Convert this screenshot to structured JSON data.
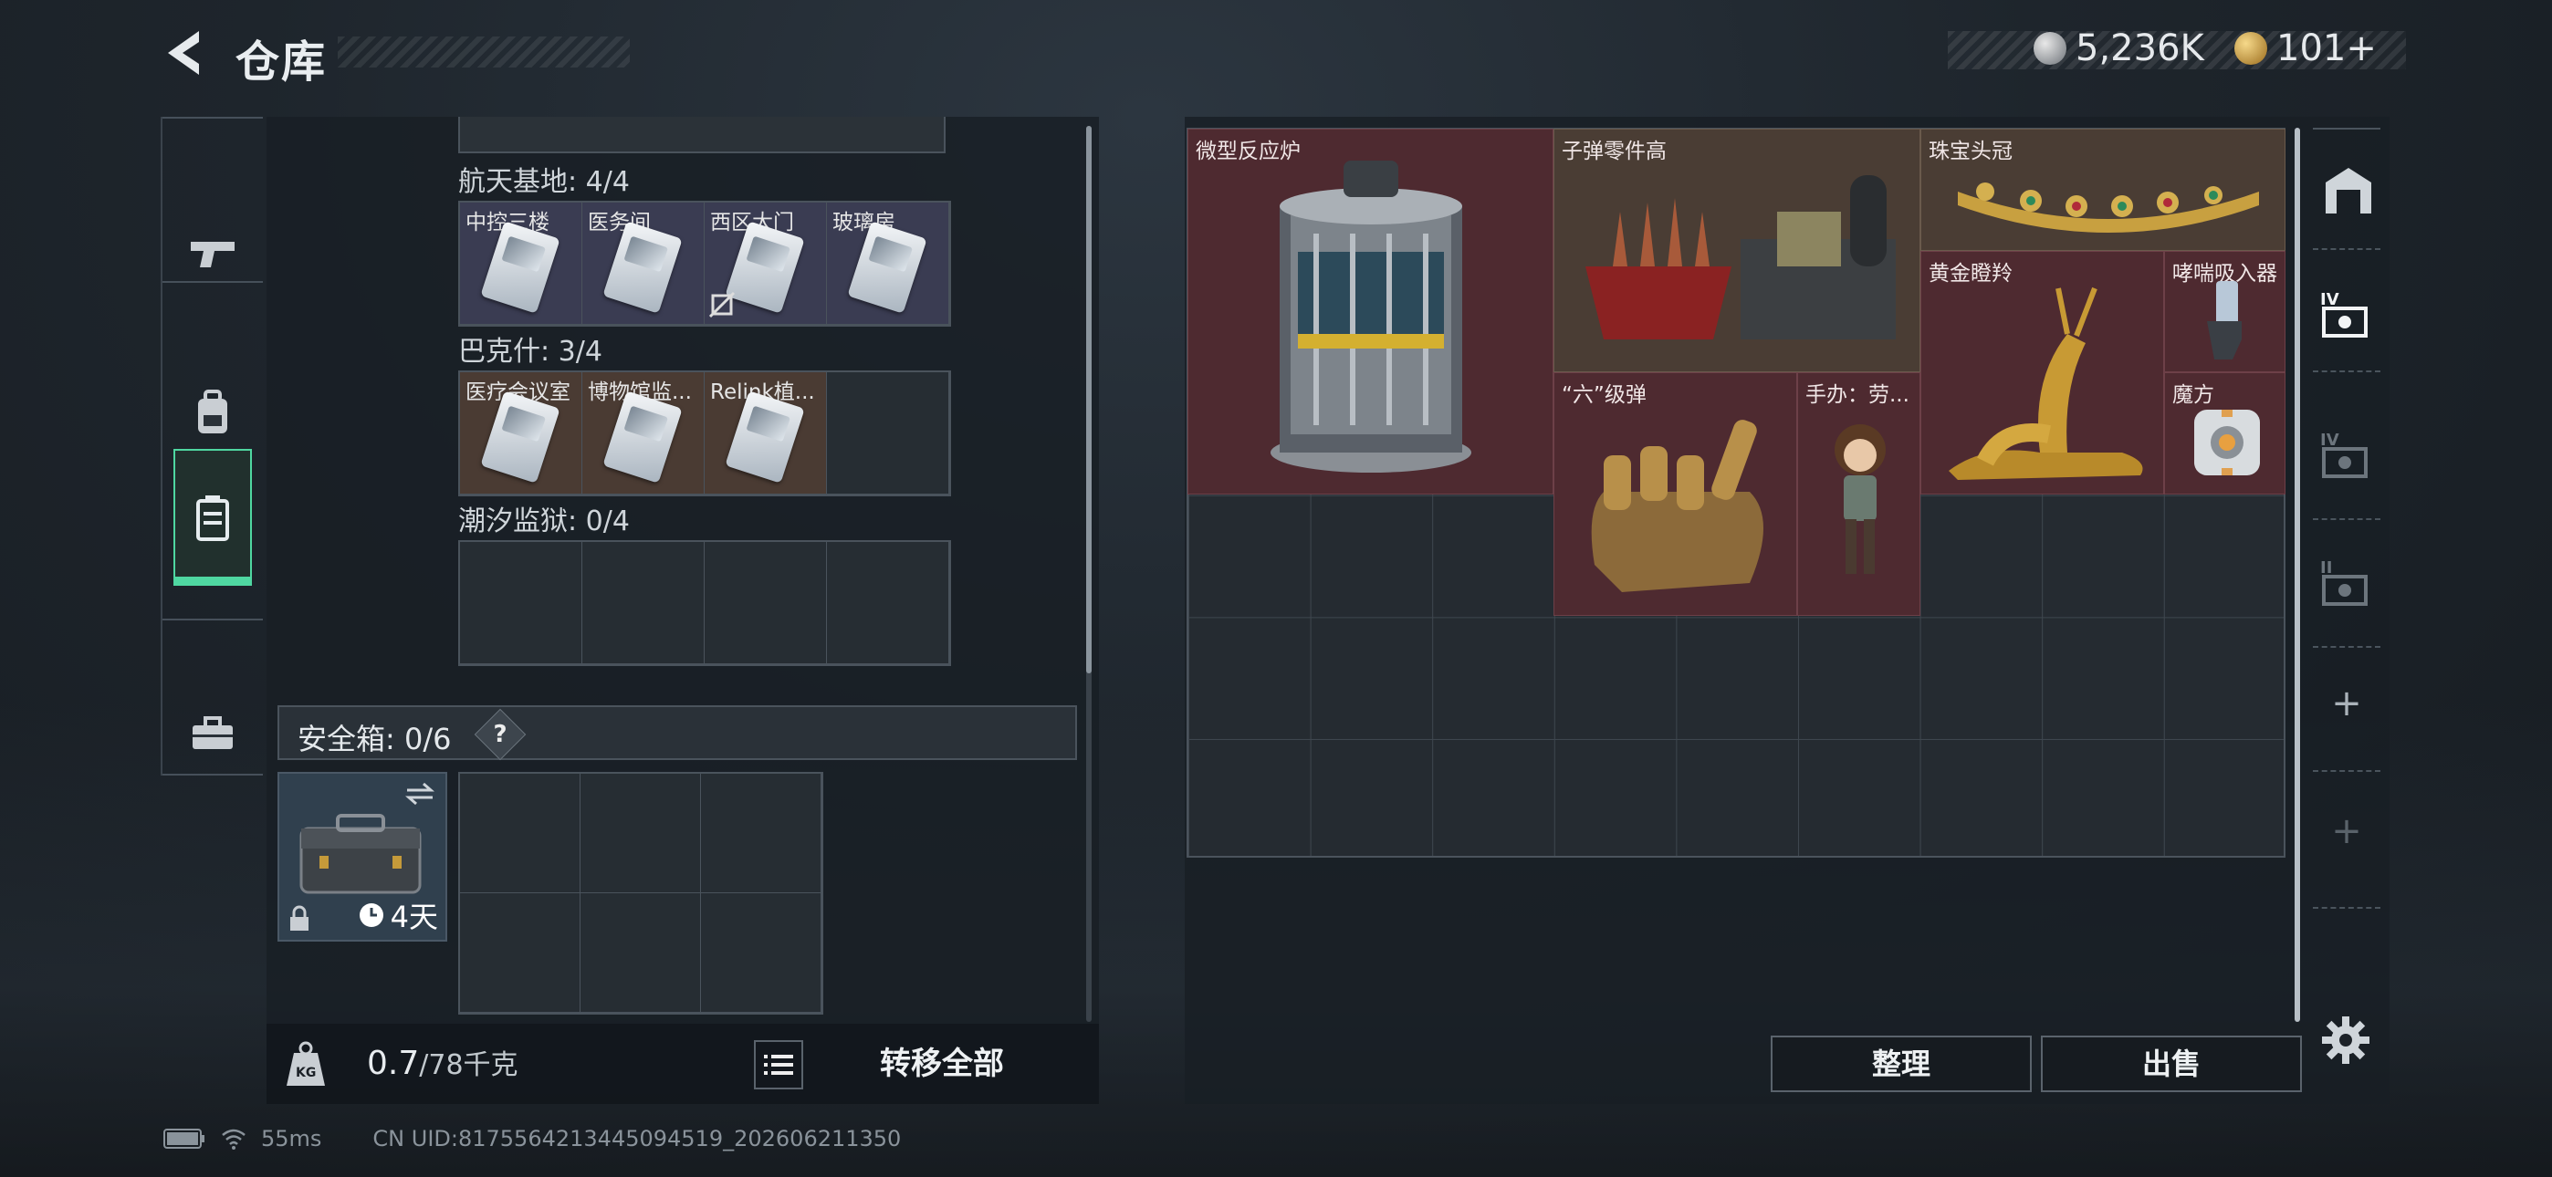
{
  "header": {
    "title": "仓库"
  },
  "currency": [
    {
      "icon": "silver-coin-icon",
      "value": "5,236K"
    },
    {
      "icon": "gold-coin-icon",
      "value": "101+"
    }
  ],
  "sidebar": {
    "items": [
      {
        "icon": "pistol-icon"
      },
      {
        "icon": "backpack-icon"
      },
      {
        "icon": "keycard-case-icon",
        "active": true
      },
      {
        "icon": "toolbox-icon"
      }
    ]
  },
  "left": {
    "groups": [
      {
        "title": "航天基地: 4/4",
        "cells": [
          "中控三楼",
          "医务间",
          "西区大门",
          "玻璃房"
        ]
      },
      {
        "title": "巴克什: 3/4",
        "cells": [
          "医疗会议室",
          "博物馆监...",
          "Relink植...",
          ""
        ]
      },
      {
        "title": "潮汐监狱: 0/4",
        "cells": [
          "",
          "",
          "",
          ""
        ]
      }
    ],
    "safe": {
      "label": "安全箱: 0/6",
      "help": "?",
      "timer": "4天"
    },
    "bottom": {
      "weight_current": "0.7",
      "weight_total": "/78千克",
      "transfer_all": "转移全部"
    }
  },
  "right": {
    "items": [
      {
        "label": "微型反应炉"
      },
      {
        "label": "子弹零件高"
      },
      {
        "label": "珠宝头冠"
      },
      {
        "label": "黄金瞪羚"
      },
      {
        "label": "哮喘吸入器"
      },
      {
        "label": "“六”级弹"
      },
      {
        "label": "手办：劳..."
      },
      {
        "label": "魔方"
      }
    ],
    "side": {
      "tabs": [
        "warehouse-icon",
        "keycard-iv-icon",
        "keycard-iv-icon",
        "keycard-ii-icon"
      ],
      "add": "+"
    },
    "buttons": {
      "sort": "整理",
      "sell": "出售"
    }
  },
  "footer": {
    "ping": "55ms",
    "uid": "CN UID:8175564213445094519_202606211350"
  },
  "colors": {
    "accent": "#4fd7a1",
    "item_bg": "#4e2a30",
    "key_bg": "#3a3c52"
  }
}
